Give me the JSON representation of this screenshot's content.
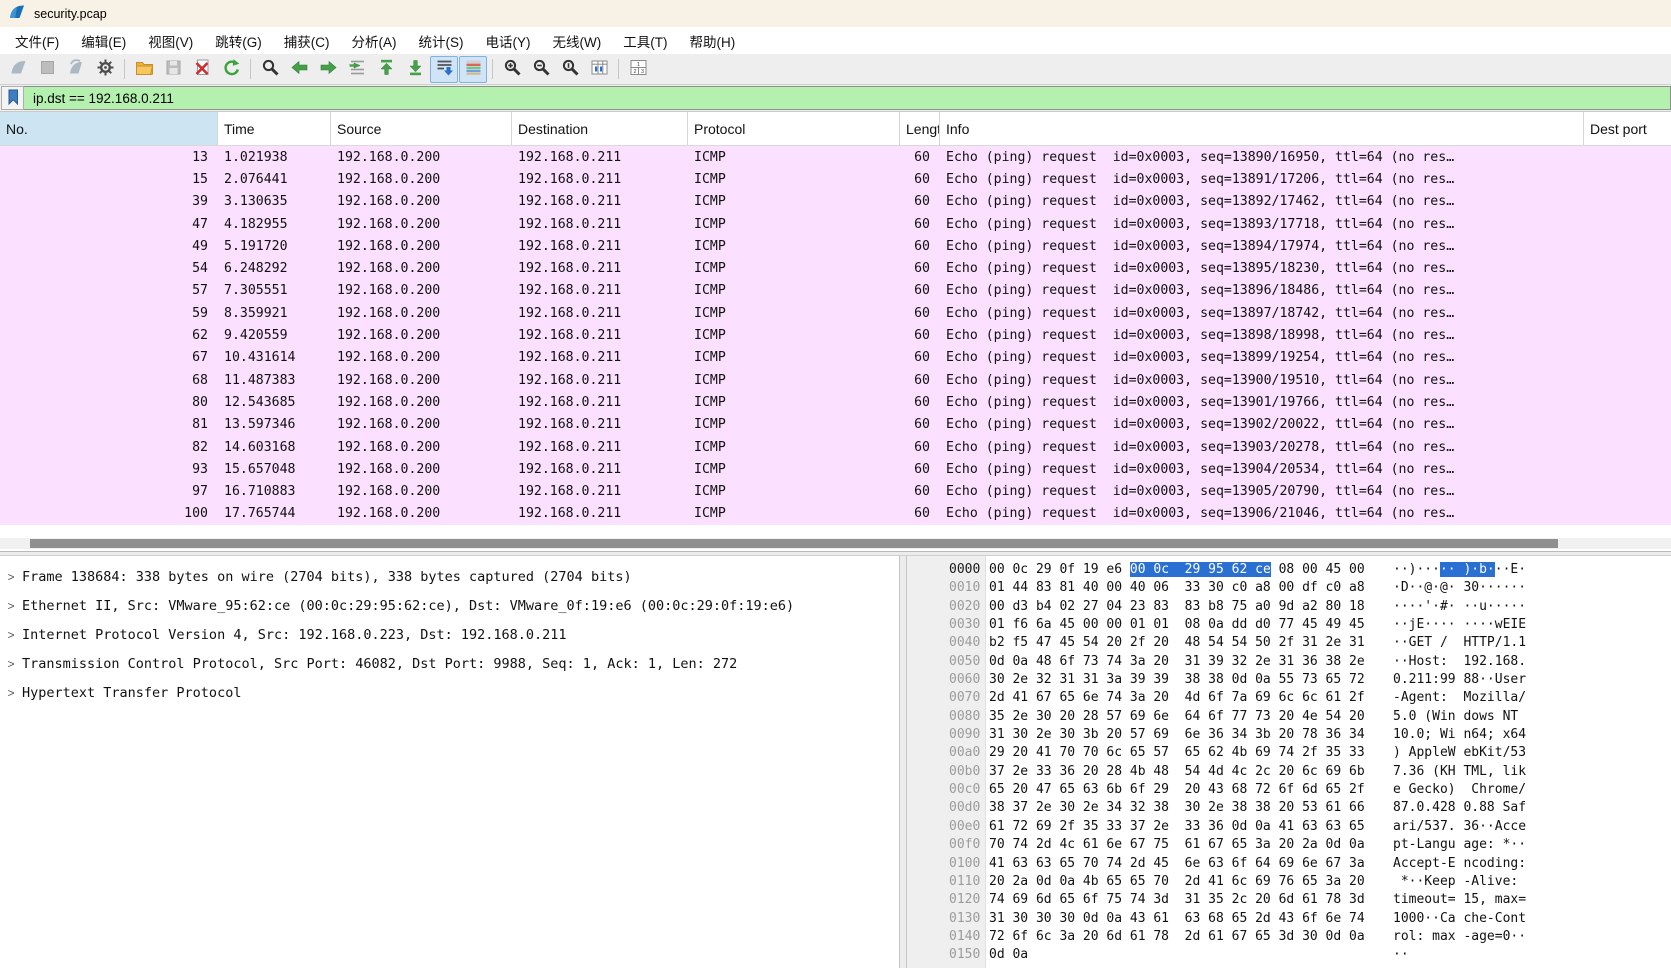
{
  "window": {
    "title": "security.pcap",
    "app_icon": "wireshark-fin-icon"
  },
  "menu": {
    "items": [
      "文件(F)",
      "编辑(E)",
      "视图(V)",
      "跳转(G)",
      "捕获(C)",
      "分析(A)",
      "统计(S)",
      "电话(Y)",
      "无线(W)",
      "工具(T)",
      "帮助(H)"
    ]
  },
  "toolbar": {
    "buttons": [
      {
        "name": "start-capture",
        "disabled": true
      },
      {
        "name": "stop-capture",
        "disabled": true
      },
      {
        "name": "restart-capture",
        "disabled": true
      },
      {
        "name": "capture-options",
        "disabled": false
      },
      {
        "sep": true
      },
      {
        "name": "open-file"
      },
      {
        "name": "save-file",
        "disabled": true
      },
      {
        "name": "close-file"
      },
      {
        "name": "reload"
      },
      {
        "sep": true
      },
      {
        "name": "find-packet"
      },
      {
        "name": "go-back"
      },
      {
        "name": "go-forward"
      },
      {
        "name": "go-to-packet"
      },
      {
        "name": "go-first"
      },
      {
        "name": "go-last"
      },
      {
        "name": "auto-scroll",
        "active": true
      },
      {
        "name": "colorize",
        "active": true
      },
      {
        "sep": true
      },
      {
        "name": "zoom-in"
      },
      {
        "name": "zoom-out"
      },
      {
        "name": "zoom-reset"
      },
      {
        "name": "resize-columns"
      },
      {
        "sep": true
      },
      {
        "name": "layout-panes"
      }
    ]
  },
  "filter": {
    "value": "ip.dst == 192.168.0.211",
    "bookmark_icon": "bookmark-icon"
  },
  "colors": {
    "icmp_row_bg": "#fce0ff",
    "filter_valid_bg": "#b5f1ae",
    "byte_selection_bg": "#2a6fd2",
    "sorted_header_bg": "#cde4f3",
    "titlebar_bg": "#f8f2e6"
  },
  "packet_list": {
    "columns": [
      "No.",
      "Time",
      "Source",
      "Destination",
      "Protocol",
      "Lengt",
      "Info",
      "Dest port"
    ],
    "rows": [
      {
        "no": "13",
        "time": "1.021938",
        "source": "192.168.0.200",
        "destination": "192.168.0.211",
        "protocol": "ICMP",
        "length": "60",
        "info": "Echo (ping) request  id=0x0003, seq=13890/16950, ttl=64 (no res…",
        "dest_port": ""
      },
      {
        "no": "15",
        "time": "2.076441",
        "source": "192.168.0.200",
        "destination": "192.168.0.211",
        "protocol": "ICMP",
        "length": "60",
        "info": "Echo (ping) request  id=0x0003, seq=13891/17206, ttl=64 (no res…",
        "dest_port": ""
      },
      {
        "no": "39",
        "time": "3.130635",
        "source": "192.168.0.200",
        "destination": "192.168.0.211",
        "protocol": "ICMP",
        "length": "60",
        "info": "Echo (ping) request  id=0x0003, seq=13892/17462, ttl=64 (no res…",
        "dest_port": ""
      },
      {
        "no": "47",
        "time": "4.182955",
        "source": "192.168.0.200",
        "destination": "192.168.0.211",
        "protocol": "ICMP",
        "length": "60",
        "info": "Echo (ping) request  id=0x0003, seq=13893/17718, ttl=64 (no res…",
        "dest_port": ""
      },
      {
        "no": "49",
        "time": "5.191720",
        "source": "192.168.0.200",
        "destination": "192.168.0.211",
        "protocol": "ICMP",
        "length": "60",
        "info": "Echo (ping) request  id=0x0003, seq=13894/17974, ttl=64 (no res…",
        "dest_port": ""
      },
      {
        "no": "54",
        "time": "6.248292",
        "source": "192.168.0.200",
        "destination": "192.168.0.211",
        "protocol": "ICMP",
        "length": "60",
        "info": "Echo (ping) request  id=0x0003, seq=13895/18230, ttl=64 (no res…",
        "dest_port": ""
      },
      {
        "no": "57",
        "time": "7.305551",
        "source": "192.168.0.200",
        "destination": "192.168.0.211",
        "protocol": "ICMP",
        "length": "60",
        "info": "Echo (ping) request  id=0x0003, seq=13896/18486, ttl=64 (no res…",
        "dest_port": ""
      },
      {
        "no": "59",
        "time": "8.359921",
        "source": "192.168.0.200",
        "destination": "192.168.0.211",
        "protocol": "ICMP",
        "length": "60",
        "info": "Echo (ping) request  id=0x0003, seq=13897/18742, ttl=64 (no res…",
        "dest_port": ""
      },
      {
        "no": "62",
        "time": "9.420559",
        "source": "192.168.0.200",
        "destination": "192.168.0.211",
        "protocol": "ICMP",
        "length": "60",
        "info": "Echo (ping) request  id=0x0003, seq=13898/18998, ttl=64 (no res…",
        "dest_port": ""
      },
      {
        "no": "67",
        "time": "10.431614",
        "source": "192.168.0.200",
        "destination": "192.168.0.211",
        "protocol": "ICMP",
        "length": "60",
        "info": "Echo (ping) request  id=0x0003, seq=13899/19254, ttl=64 (no res…",
        "dest_port": ""
      },
      {
        "no": "68",
        "time": "11.487383",
        "source": "192.168.0.200",
        "destination": "192.168.0.211",
        "protocol": "ICMP",
        "length": "60",
        "info": "Echo (ping) request  id=0x0003, seq=13900/19510, ttl=64 (no res…",
        "dest_port": ""
      },
      {
        "no": "80",
        "time": "12.543685",
        "source": "192.168.0.200",
        "destination": "192.168.0.211",
        "protocol": "ICMP",
        "length": "60",
        "info": "Echo (ping) request  id=0x0003, seq=13901/19766, ttl=64 (no res…",
        "dest_port": ""
      },
      {
        "no": "81",
        "time": "13.597346",
        "source": "192.168.0.200",
        "destination": "192.168.0.211",
        "protocol": "ICMP",
        "length": "60",
        "info": "Echo (ping) request  id=0x0003, seq=13902/20022, ttl=64 (no res…",
        "dest_port": ""
      },
      {
        "no": "82",
        "time": "14.603168",
        "source": "192.168.0.200",
        "destination": "192.168.0.211",
        "protocol": "ICMP",
        "length": "60",
        "info": "Echo (ping) request  id=0x0003, seq=13903/20278, ttl=64 (no res…",
        "dest_port": ""
      },
      {
        "no": "93",
        "time": "15.657048",
        "source": "192.168.0.200",
        "destination": "192.168.0.211",
        "protocol": "ICMP",
        "length": "60",
        "info": "Echo (ping) request  id=0x0003, seq=13904/20534, ttl=64 (no res…",
        "dest_port": ""
      },
      {
        "no": "97",
        "time": "16.710883",
        "source": "192.168.0.200",
        "destination": "192.168.0.211",
        "protocol": "ICMP",
        "length": "60",
        "info": "Echo (ping) request  id=0x0003, seq=13905/20790, ttl=64 (no res…",
        "dest_port": ""
      },
      {
        "no": "100",
        "time": "17.765744",
        "source": "192.168.0.200",
        "destination": "192.168.0.211",
        "protocol": "ICMP",
        "length": "60",
        "info": "Echo (ping) request  id=0x0003, seq=13906/21046, ttl=64 (no res…",
        "dest_port": ""
      }
    ]
  },
  "packet_details": {
    "lines": [
      "Frame 138684: 338 bytes on wire (2704 bits), 338 bytes captured (2704 bits)",
      "Ethernet II, Src: VMware_95:62:ce (00:0c:29:95:62:ce), Dst: VMware_0f:19:e6 (00:0c:29:0f:19:e6)",
      "Internet Protocol Version 4, Src: 192.168.0.223, Dst: 192.168.0.211",
      "Transmission Control Protocol, Src Port: 46082, Dst Port: 9988, Seq: 1, Ack: 1, Len: 272",
      "Hypertext Transfer Protocol"
    ]
  },
  "hex_view": {
    "rows": [
      {
        "offset": "0000",
        "current": true,
        "hex_pre": "00 0c 29 0f 19 e6 ",
        "hex_sel": "00 0c  29 95 62 ce",
        "hex_post": " 08 00 45 00",
        "ascii_pre": "··)···",
        "ascii_sel": "·· )·b·",
        "ascii_post": "··E·"
      },
      {
        "offset": "0010",
        "hex": "01 44 83 81 40 00 40 06  33 30 c0 a8 00 df c0 a8",
        "ascii": "·D··@·@· 30······"
      },
      {
        "offset": "0020",
        "hex": "00 d3 b4 02 27 04 23 83  83 b8 75 a0 9d a2 80 18",
        "ascii": "····'·#· ··u·····"
      },
      {
        "offset": "0030",
        "hex": "01 f6 6a 45 00 00 01 01  08 0a dd d0 77 45 49 45",
        "ascii": "··jE···· ····wEIE"
      },
      {
        "offset": "0040",
        "hex": "b2 f5 47 45 54 20 2f 20  48 54 54 50 2f 31 2e 31",
        "ascii": "··GET /  HTTP/1.1"
      },
      {
        "offset": "0050",
        "hex": "0d 0a 48 6f 73 74 3a 20  31 39 32 2e 31 36 38 2e",
        "ascii": "··Host:  192.168."
      },
      {
        "offset": "0060",
        "hex": "30 2e 32 31 31 3a 39 39  38 38 0d 0a 55 73 65 72",
        "ascii": "0.211:99 88··User"
      },
      {
        "offset": "0070",
        "hex": "2d 41 67 65 6e 74 3a 20  4d 6f 7a 69 6c 6c 61 2f",
        "ascii": "-Agent:  Mozilla/"
      },
      {
        "offset": "0080",
        "hex": "35 2e 30 20 28 57 69 6e  64 6f 77 73 20 4e 54 20",
        "ascii": "5.0 (Win dows NT "
      },
      {
        "offset": "0090",
        "hex": "31 30 2e 30 3b 20 57 69  6e 36 34 3b 20 78 36 34",
        "ascii": "10.0; Wi n64; x64"
      },
      {
        "offset": "00a0",
        "hex": "29 20 41 70 70 6c 65 57  65 62 4b 69 74 2f 35 33",
        "ascii": ") AppleW ebKit/53"
      },
      {
        "offset": "00b0",
        "hex": "37 2e 33 36 20 28 4b 48  54 4d 4c 2c 20 6c 69 6b",
        "ascii": "7.36 (KH TML, lik"
      },
      {
        "offset": "00c0",
        "hex": "65 20 47 65 63 6b 6f 29  20 43 68 72 6f 6d 65 2f",
        "ascii": "e Gecko)  Chrome/"
      },
      {
        "offset": "00d0",
        "hex": "38 37 2e 30 2e 34 32 38  30 2e 38 38 20 53 61 66",
        "ascii": "87.0.428 0.88 Saf"
      },
      {
        "offset": "00e0",
        "hex": "61 72 69 2f 35 33 37 2e  33 36 0d 0a 41 63 63 65",
        "ascii": "ari/537. 36··Acce"
      },
      {
        "offset": "00f0",
        "hex": "70 74 2d 4c 61 6e 67 75  61 67 65 3a 20 2a 0d 0a",
        "ascii": "pt-Langu age: *··"
      },
      {
        "offset": "0100",
        "hex": "41 63 63 65 70 74 2d 45  6e 63 6f 64 69 6e 67 3a",
        "ascii": "Accept-E ncoding:"
      },
      {
        "offset": "0110",
        "hex": "20 2a 0d 0a 4b 65 65 70  2d 41 6c 69 76 65 3a 20",
        "ascii": " *··Keep -Alive: "
      },
      {
        "offset": "0120",
        "hex": "74 69 6d 65 6f 75 74 3d  31 35 2c 20 6d 61 78 3d",
        "ascii": "timeout= 15, max="
      },
      {
        "offset": "0130",
        "hex": "31 30 30 30 0d 0a 43 61  63 68 65 2d 43 6f 6e 74",
        "ascii": "1000··Ca che-Cont"
      },
      {
        "offset": "0140",
        "hex": "72 6f 6c 3a 20 6d 61 78  2d 61 67 65 3d 30 0d 0a",
        "ascii": "rol: max -age=0··"
      },
      {
        "offset": "0150",
        "hex": "0d 0a",
        "ascii": "··"
      }
    ]
  }
}
